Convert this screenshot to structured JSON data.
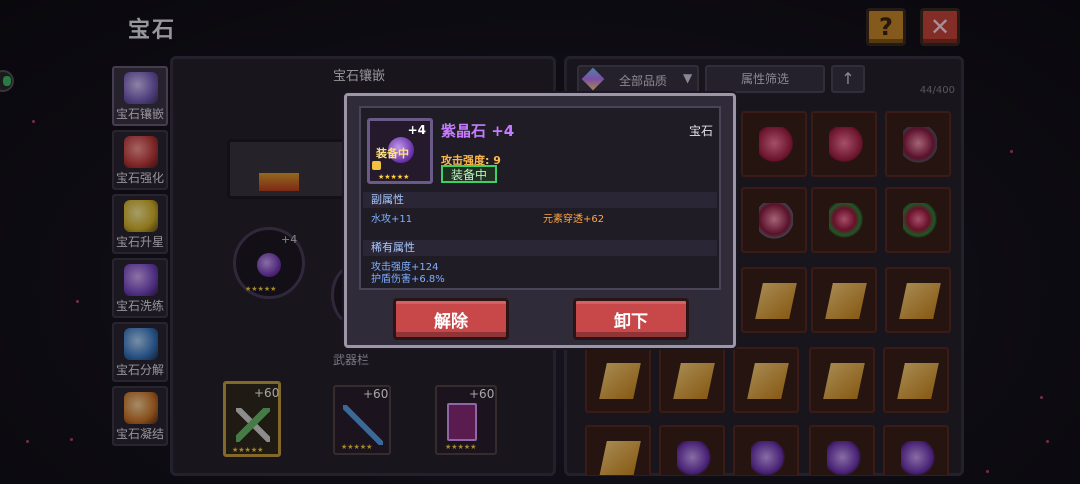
{
  "header": {
    "title": "宝石"
  },
  "side_menu": [
    {
      "label": "宝石镶嵌",
      "icon": "egg-gem-icon",
      "color": "#9b84d8",
      "active": true
    },
    {
      "label": "宝石强化",
      "icon": "heart-gem-icon",
      "color": "#d24a4a",
      "active": false
    },
    {
      "label": "宝石升星",
      "icon": "star-icon",
      "color": "#e0c43a",
      "active": false
    },
    {
      "label": "宝石洗练",
      "icon": "purple-crystal-icon",
      "color": "#8a5ad0",
      "active": false
    },
    {
      "label": "宝石分解",
      "icon": "blue-shard-icon",
      "color": "#4a8ad8",
      "active": false
    },
    {
      "label": "宝石凝结",
      "icon": "orange-feather-icon",
      "color": "#e08a30",
      "active": false
    }
  ],
  "inlay_panel": {
    "title": "宝石镶嵌",
    "slot_plus": "+4",
    "weapon_bar_label": "武器栏",
    "weapons": [
      {
        "plus": "+60",
        "icon": "rifle-icon"
      },
      {
        "plus": "+60",
        "icon": "spear-icon"
      },
      {
        "plus": "+60",
        "icon": "spellbook-icon"
      }
    ]
  },
  "inventory": {
    "quality_filter": "全部品质",
    "attr_filter": "属性筛选",
    "count": "44/400"
  },
  "modal": {
    "item_plus": "+4",
    "equipped_tag": "装备中",
    "name": "紫晶石 +4",
    "category": "宝石",
    "attack": "攻击强度: 9",
    "equipped_button": "装备中",
    "sub_attr_title": "副属性",
    "sub_attrs": {
      "left": "水攻+11",
      "right": "元素穿透+62"
    },
    "rare_attr_title": "稀有属性",
    "rare_attrs": [
      "攻击强度+124",
      "护盾伤害+6.8%"
    ],
    "buttons": {
      "unsocket": "解除",
      "unequip": "卸下"
    }
  },
  "colors": {
    "accent_red": "#c8484a",
    "name_purple": "#c77cff",
    "equipped_green": "#3cd06a",
    "attack_orange": "#ffb84a"
  }
}
